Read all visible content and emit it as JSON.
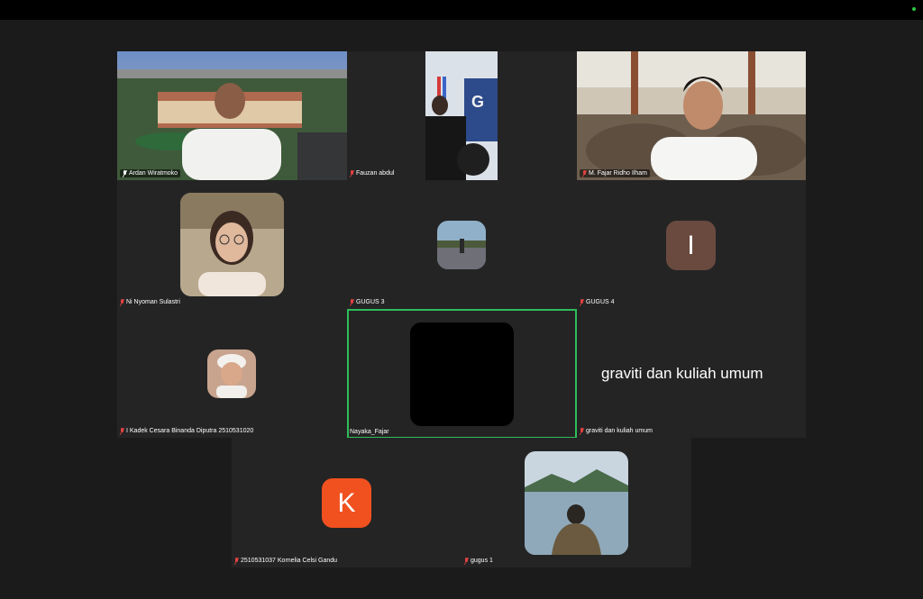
{
  "meeting": {
    "status_color": "#27c93f",
    "active_speaker_border": "#2ebd59",
    "participants": [
      {
        "name": "Ardan Wiratmoko",
        "muted": true,
        "video": true
      },
      {
        "name": "Fauzan abdul",
        "muted": true,
        "video": true
      },
      {
        "name": "M. Fajar Ridho Ilham",
        "muted": true,
        "video": true
      },
      {
        "name": "Ni Nyoman Sulastri",
        "muted": true,
        "video": false
      },
      {
        "name": "GUGUS 3",
        "muted": true,
        "video": false
      },
      {
        "name": "GUGUS 4",
        "muted": true,
        "video": false,
        "avatar_letter": "I",
        "avatar_color": "#6a4a3f"
      },
      {
        "name": "I Kadek Cesara Binanda Diputra 2510531020",
        "muted": true,
        "video": false
      },
      {
        "name": "Nayaka_Fajar",
        "muted": false,
        "video": false,
        "active": true
      },
      {
        "name": "graviti dan kuliah umum",
        "muted": true,
        "video": false,
        "display_text": "graviti dan kuliah umum"
      },
      {
        "name": "2510531037 Kornelia Celsi Gandu",
        "muted": true,
        "video": false,
        "avatar_letter": "K",
        "avatar_color": "#f0511f"
      },
      {
        "name": "gugus 1",
        "muted": true,
        "video": false
      }
    ]
  }
}
